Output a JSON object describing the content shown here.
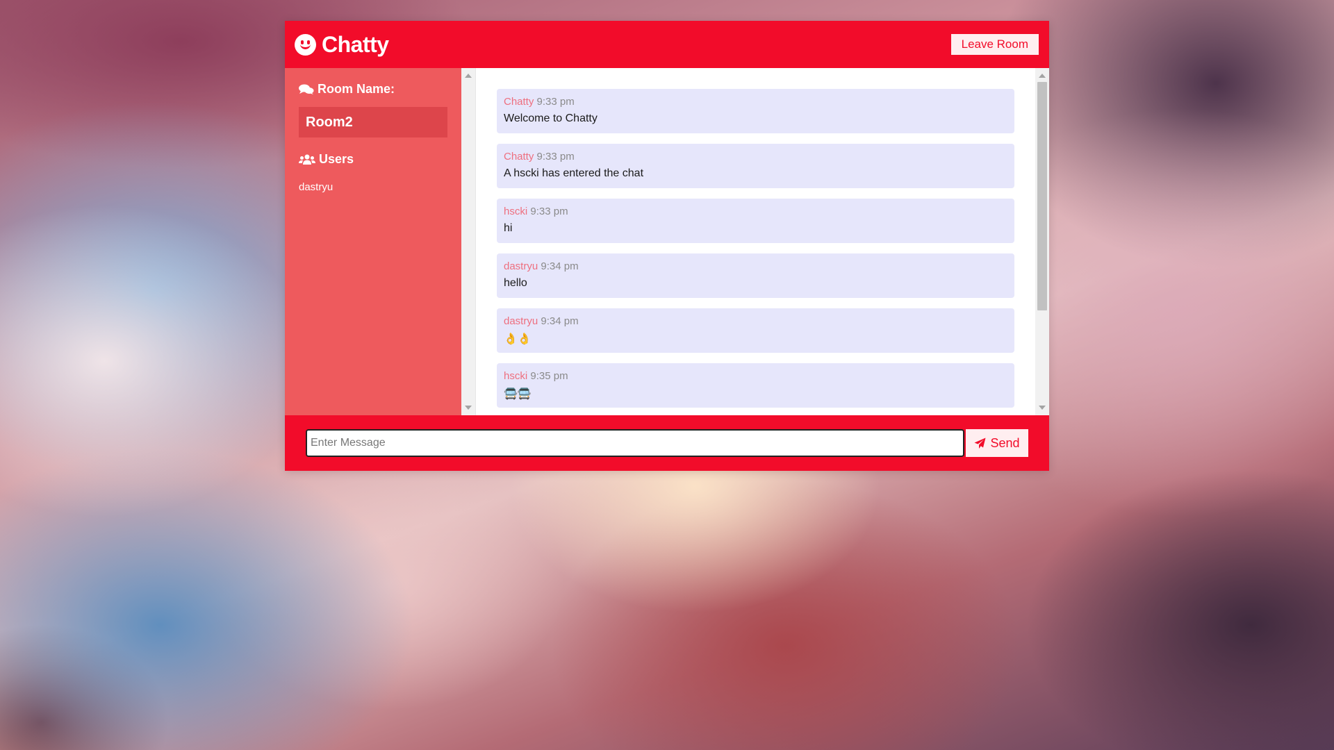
{
  "header": {
    "title": "Chatty",
    "leave_label": "Leave Room",
    "icon": "smile-icon"
  },
  "sidebar": {
    "room_heading": "Room Name:",
    "room_name": "Room2",
    "users_heading": "Users",
    "users": [
      "dastryu"
    ]
  },
  "messages": [
    {
      "author": "Chatty",
      "time": "9:33 pm",
      "text": "Welcome to Chatty"
    },
    {
      "author": "Chatty",
      "time": "9:33 pm",
      "text": "A hscki has entered the chat"
    },
    {
      "author": "hscki",
      "time": "9:33 pm",
      "text": "hi"
    },
    {
      "author": "dastryu",
      "time": "9:34 pm",
      "text": "hello"
    },
    {
      "author": "dastryu",
      "time": "9:34 pm",
      "text": "👌👌"
    },
    {
      "author": "hscki",
      "time": "9:35 pm",
      "text": "🚍🚍"
    }
  ],
  "composer": {
    "placeholder": "Enter Message",
    "value": "",
    "send_label": "Send"
  },
  "colors": {
    "primary": "#f20c2a",
    "sidebar": "#ee5a5d",
    "message_bg": "#e6e6fb",
    "author": "#ee6f7f"
  }
}
